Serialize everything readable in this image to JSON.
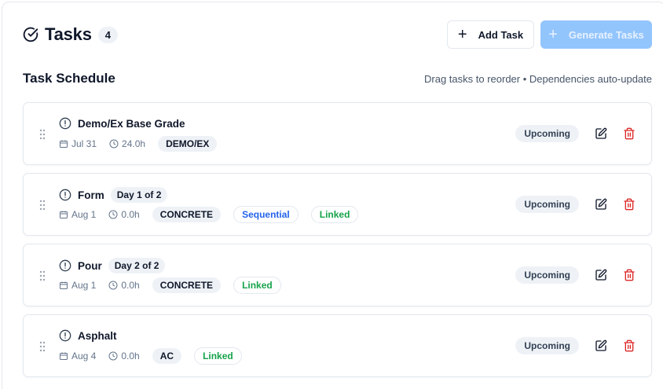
{
  "header": {
    "title": "Tasks",
    "count": "4",
    "add_task_label": "Add Task",
    "generate_tasks_label": "Generate Tasks"
  },
  "schedule": {
    "title": "Task Schedule",
    "hint": "Drag tasks to reorder • Dependencies auto-update"
  },
  "tasks": [
    {
      "name": "Demo/Ex Base Grade",
      "day": "",
      "date": "Jul 31",
      "hours": "24.0h",
      "code": "DEMO/EX",
      "sequential": "",
      "linked": "",
      "status": "Upcoming"
    },
    {
      "name": "Form",
      "day": "Day 1 of 2",
      "date": "Aug 1",
      "hours": "0.0h",
      "code": "CONCRETE",
      "sequential": "Sequential",
      "linked": "Linked",
      "status": "Upcoming"
    },
    {
      "name": "Pour",
      "day": "Day 2 of 2",
      "date": "Aug 1",
      "hours": "0.0h",
      "code": "CONCRETE",
      "sequential": "",
      "linked": "Linked",
      "status": "Upcoming"
    },
    {
      "name": "Asphalt",
      "day": "",
      "date": "Aug 4",
      "hours": "0.0h",
      "code": "AC",
      "sequential": "",
      "linked": "Linked",
      "status": "Upcoming"
    }
  ],
  "colors": {
    "primary_disabled": "#93c5fd",
    "delete": "#dc2626",
    "sequential": "#2563eb",
    "linked": "#16a34a"
  },
  "icons": {
    "title": "check-circle-icon",
    "task": "alert-circle-icon",
    "date": "calendar-icon",
    "hours": "clock-icon",
    "edit": "edit-icon",
    "delete": "trash-icon",
    "drag": "grip-vertical-icon"
  }
}
